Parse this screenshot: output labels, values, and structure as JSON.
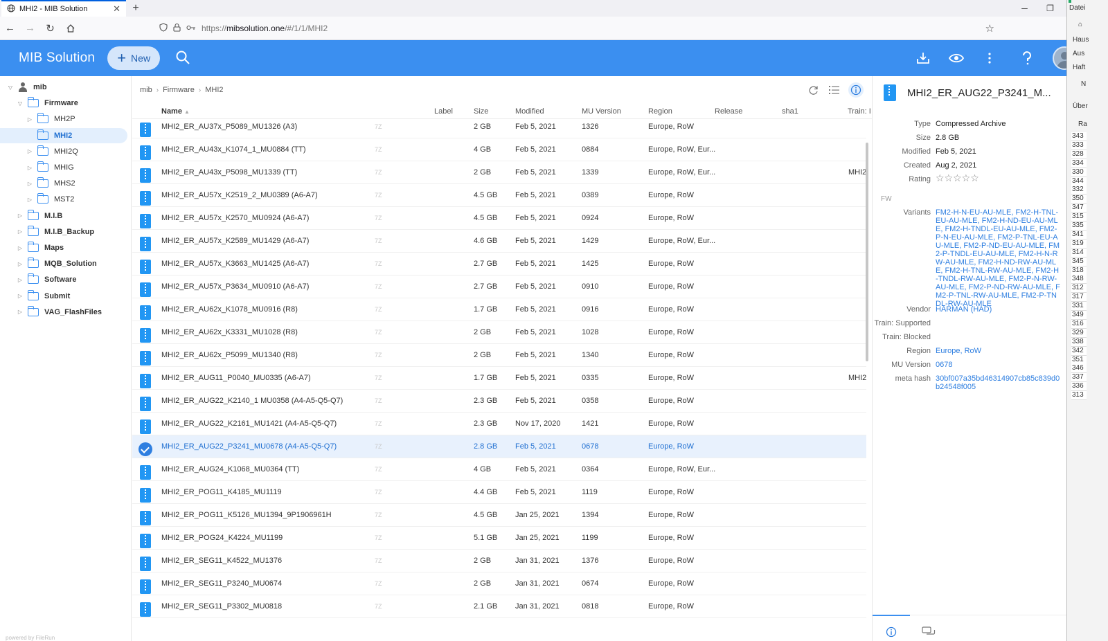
{
  "browser": {
    "tab_title": "MHI2 - MIB Solution",
    "url_prefix": "https://",
    "url_host": "mibsolution.one",
    "url_path": "/#/1/1/MHI2"
  },
  "app": {
    "brand": "MIB Solution",
    "new_label": "New"
  },
  "tree": [
    {
      "label": "mib",
      "level": 0,
      "type": "user",
      "arrow": "open"
    },
    {
      "label": "Firmware",
      "level": 1,
      "type": "folder",
      "arrow": "open"
    },
    {
      "label": "MH2P",
      "level": 2,
      "type": "folder",
      "arrow": "closed"
    },
    {
      "label": "MHI2",
      "level": 2,
      "type": "folder",
      "arrow": "none",
      "active": true
    },
    {
      "label": "MHI2Q",
      "level": 2,
      "type": "folder",
      "arrow": "closed"
    },
    {
      "label": "MHIG",
      "level": 2,
      "type": "folder",
      "arrow": "closed"
    },
    {
      "label": "MHS2",
      "level": 2,
      "type": "folder",
      "arrow": "closed"
    },
    {
      "label": "MST2",
      "level": 2,
      "type": "folder",
      "arrow": "closed"
    },
    {
      "label": "M.I.B",
      "level": 1,
      "type": "folder",
      "arrow": "closed"
    },
    {
      "label": "M.I.B_Backup",
      "level": 1,
      "type": "folder",
      "arrow": "closed"
    },
    {
      "label": "Maps",
      "level": 1,
      "type": "folder",
      "arrow": "closed"
    },
    {
      "label": "MQB_Solution",
      "level": 1,
      "type": "folder",
      "arrow": "closed"
    },
    {
      "label": "Software",
      "level": 1,
      "type": "folder",
      "arrow": "closed"
    },
    {
      "label": "Submit",
      "level": 1,
      "type": "folder",
      "arrow": "closed"
    },
    {
      "label": "VAG_FlashFiles",
      "level": 1,
      "type": "folder",
      "arrow": "closed"
    }
  ],
  "powered_by": "powered by FileRun",
  "breadcrumb": [
    "mib",
    "Firmware",
    "MHI2"
  ],
  "columns": {
    "name": "Name",
    "label": "Label",
    "size": "Size",
    "modified": "Modified",
    "mu_version": "MU Version",
    "region": "Region",
    "release": "Release",
    "sha1": "sha1",
    "train": "Train: I"
  },
  "files": [
    {
      "name": "MHI2_ER_AU37x_P5089_MU1326 (A3)",
      "ext": "7Z",
      "size": "2 GB",
      "modified": "Feb 5, 2021",
      "mu": "1326",
      "region": "Europe, RoW",
      "train": ""
    },
    {
      "name": "MHI2_ER_AU43x_K1074_1_MU0884 (TT)",
      "ext": "7Z",
      "size": "4 GB",
      "modified": "Feb 5, 2021",
      "mu": "0884",
      "region": "Europe, RoW, Eur...",
      "train": ""
    },
    {
      "name": "MHI2_ER_AU43x_P5098_MU1339 (TT)",
      "ext": "7Z",
      "size": "2 GB",
      "modified": "Feb 5, 2021",
      "mu": "1339",
      "region": "Europe, RoW, Eur...",
      "train": "MHI2"
    },
    {
      "name": "MHI2_ER_AU57x_K2519_2_MU0389 (A6-A7)",
      "ext": "7Z",
      "size": "4.5 GB",
      "modified": "Feb 5, 2021",
      "mu": "0389",
      "region": "Europe, RoW",
      "train": ""
    },
    {
      "name": "MHI2_ER_AU57x_K2570_MU0924 (A6-A7)",
      "ext": "7Z",
      "size": "4.5 GB",
      "modified": "Feb 5, 2021",
      "mu": "0924",
      "region": "Europe, RoW",
      "train": ""
    },
    {
      "name": "MHI2_ER_AU57x_K2589_MU1429 (A6-A7)",
      "ext": "7Z",
      "size": "4.6 GB",
      "modified": "Feb 5, 2021",
      "mu": "1429",
      "region": "Europe, RoW, Eur...",
      "train": ""
    },
    {
      "name": "MHI2_ER_AU57x_K3663_MU1425 (A6-A7)",
      "ext": "7Z",
      "size": "2.7 GB",
      "modified": "Feb 5, 2021",
      "mu": "1425",
      "region": "Europe, RoW",
      "train": ""
    },
    {
      "name": "MHI2_ER_AU57x_P3634_MU0910 (A6-A7)",
      "ext": "7Z",
      "size": "2.7 GB",
      "modified": "Feb 5, 2021",
      "mu": "0910",
      "region": "Europe, RoW",
      "train": ""
    },
    {
      "name": "MHI2_ER_AU62x_K1078_MU0916 (R8)",
      "ext": "7Z",
      "size": "1.7 GB",
      "modified": "Feb 5, 2021",
      "mu": "0916",
      "region": "Europe, RoW",
      "train": ""
    },
    {
      "name": "MHI2_ER_AU62x_K3331_MU1028 (R8)",
      "ext": "7Z",
      "size": "2 GB",
      "modified": "Feb 5, 2021",
      "mu": "1028",
      "region": "Europe, RoW",
      "train": ""
    },
    {
      "name": "MHI2_ER_AU62x_P5099_MU1340 (R8)",
      "ext": "7Z",
      "size": "2 GB",
      "modified": "Feb 5, 2021",
      "mu": "1340",
      "region": "Europe, RoW",
      "train": ""
    },
    {
      "name": "MHI2_ER_AUG11_P0040_MU0335 (A6-A7)",
      "ext": "7Z",
      "size": "1.7 GB",
      "modified": "Feb 5, 2021",
      "mu": "0335",
      "region": "Europe, RoW",
      "train": "MHI2"
    },
    {
      "name": "MHI2_ER_AUG22_K2140_1 MU0358 (A4-A5-Q5-Q7)",
      "ext": "7Z",
      "size": "2.3 GB",
      "modified": "Feb 5, 2021",
      "mu": "0358",
      "region": "Europe, RoW",
      "train": ""
    },
    {
      "name": "MHI2_ER_AUG22_K2161_MU1421 (A4-A5-Q5-Q7)",
      "ext": "7Z",
      "size": "2.3 GB",
      "modified": "Nov 17, 2020",
      "mu": "1421",
      "region": "Europe, RoW",
      "train": ""
    },
    {
      "name": "MHI2_ER_AUG22_P3241_MU0678 (A4-A5-Q5-Q7)",
      "ext": "7Z",
      "size": "2.8 GB",
      "modified": "Feb 5, 2021",
      "mu": "0678",
      "region": "Europe, RoW",
      "train": "",
      "selected": true
    },
    {
      "name": "MHI2_ER_AUG24_K1068_MU0364 (TT)",
      "ext": "7Z",
      "size": "4 GB",
      "modified": "Feb 5, 2021",
      "mu": "0364",
      "region": "Europe, RoW, Eur...",
      "train": ""
    },
    {
      "name": "MHI2_ER_POG11_K4185_MU1119",
      "ext": "7Z",
      "size": "4.4 GB",
      "modified": "Feb 5, 2021",
      "mu": "1119",
      "region": "Europe, RoW",
      "train": ""
    },
    {
      "name": "MHI2_ER_POG11_K5126_MU1394_9P1906961H",
      "ext": "7Z",
      "size": "4.5 GB",
      "modified": "Jan 25, 2021",
      "mu": "1394",
      "region": "Europe, RoW",
      "train": ""
    },
    {
      "name": "MHI2_ER_POG24_K4224_MU1199",
      "ext": "7Z",
      "size": "5.1 GB",
      "modified": "Jan 25, 2021",
      "mu": "1199",
      "region": "Europe, RoW",
      "train": ""
    },
    {
      "name": "MHI2_ER_SEG11_K4522_MU1376",
      "ext": "7Z",
      "size": "2 GB",
      "modified": "Jan 31, 2021",
      "mu": "1376",
      "region": "Europe, RoW",
      "train": ""
    },
    {
      "name": "MHI2_ER_SEG11_P3240_MU0674",
      "ext": "7Z",
      "size": "2 GB",
      "modified": "Jan 31, 2021",
      "mu": "0674",
      "region": "Europe, RoW",
      "train": ""
    },
    {
      "name": "MHI2_ER_SEG11_P3302_MU0818",
      "ext": "7Z",
      "size": "2.1 GB",
      "modified": "Jan 31, 2021",
      "mu": "0818",
      "region": "Europe, RoW",
      "train": ""
    }
  ],
  "detail": {
    "title": "MHI2_ER_AUG22_P3241_M...",
    "props": [
      {
        "k": "Type",
        "v": "Compressed Archive"
      },
      {
        "k": "Size",
        "v": "2.8 GB"
      },
      {
        "k": "Modified",
        "v": "Feb 5, 2021"
      },
      {
        "k": "Created",
        "v": "Aug 2, 2021"
      },
      {
        "k": "Rating",
        "v": "☆☆☆☆☆"
      }
    ],
    "section": "FW",
    "fw": [
      {
        "k": "Variants",
        "v": "FM2-H-N-EU-AU-MLE, FM2-H-TNL-EU-AU-MLE, FM2-H-ND-EU-AU-MLE, FM2-H-TNDL-EU-AU-MLE, FM2-P-N-EU-AU-MLE, FM2-P-TNL-EU-AU-MLE, FM2-P-ND-EU-AU-MLE, FM2-P-TNDL-EU-AU-MLE, FM2-H-N-RW-AU-MLE, FM2-H-ND-RW-AU-MLE, FM2-H-TNL-RW-AU-MLE, FM2-H-TNDL-RW-AU-MLE, FM2-P-N-RW-AU-MLE, FM2-P-ND-RW-AU-MLE, FM2-P-TNL-RW-AU-MLE, FM2-P-TNDL-RW-AU-MLE",
        "link": true
      },
      {
        "k": "Vendor",
        "v": "HARMAN (HAD)",
        "link": true
      },
      {
        "k": "Train: Supported",
        "v": ""
      },
      {
        "k": "Train: Blocked",
        "v": ""
      },
      {
        "k": "Region",
        "v": "Europe, RoW",
        "link": true
      },
      {
        "k": "MU Version",
        "v": "0678",
        "link": true
      },
      {
        "k": "meta hash",
        "v": "30bf007a35bd46314907cb85c839d0b24548f005",
        "link": true
      }
    ]
  },
  "edge_window": {
    "menu": "Datei",
    "labels": [
      "Haus",
      "Aus",
      "Haft",
      "N",
      "Über",
      "Ra"
    ],
    "numbers": [
      "343",
      "333",
      "328",
      "334",
      "330",
      "344",
      "332",
      "350",
      "347",
      "315",
      "335",
      "341",
      "319",
      "314",
      "345",
      "318",
      "348",
      "312",
      "317",
      "331",
      "349",
      "316",
      "329",
      "338",
      "342",
      "351",
      "346",
      "337",
      "336",
      "313"
    ]
  },
  "colors": {
    "accent": "#3b8ff0",
    "link": "#2d7ee0",
    "selected_row": "#e8f1fd"
  }
}
